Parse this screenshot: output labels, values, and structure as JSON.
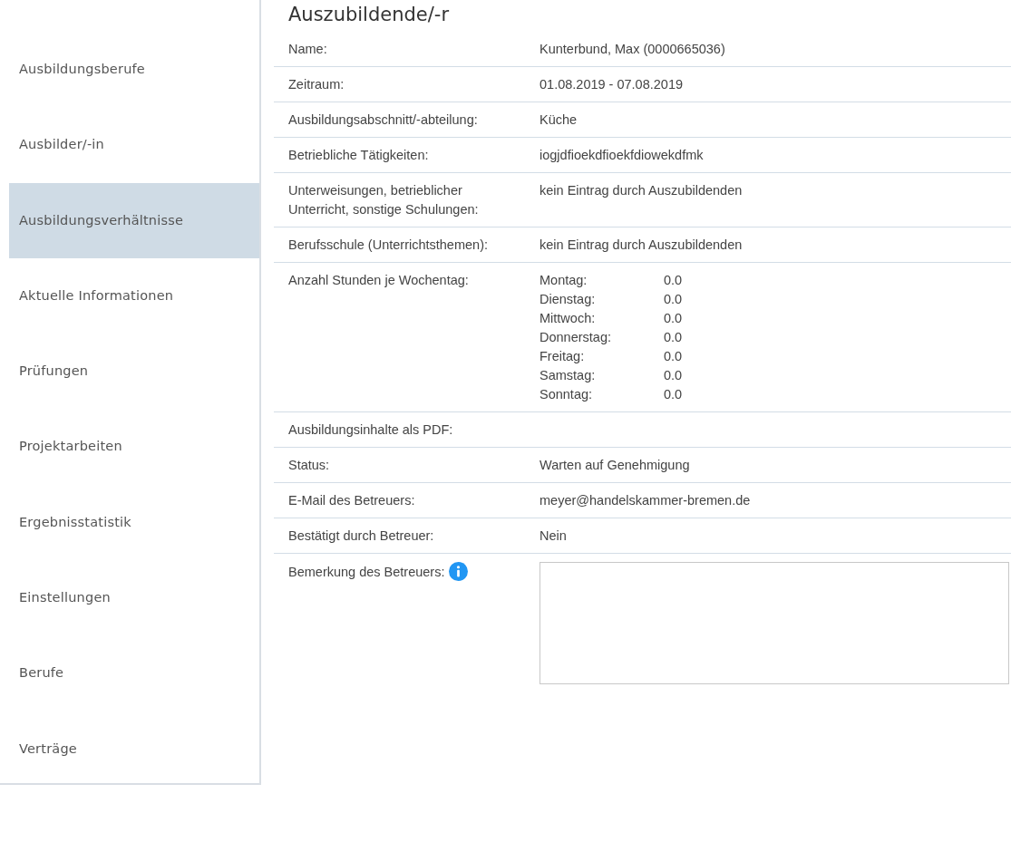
{
  "sidebar": {
    "items": [
      {
        "label": "Ausbildungsberufe",
        "selected": false
      },
      {
        "label": "Ausbilder/-in",
        "selected": false
      },
      {
        "label": "Ausbildungsverhältnisse",
        "selected": true
      },
      {
        "label": "Aktuelle Informationen",
        "selected": false
      },
      {
        "label": "Prüfungen",
        "selected": false
      },
      {
        "label": "Projektarbeiten",
        "selected": false
      },
      {
        "label": "Ergebnisstatistik",
        "selected": false
      },
      {
        "label": "Einstellungen",
        "selected": false
      },
      {
        "label": "Berufe",
        "selected": false
      },
      {
        "label": "Verträge",
        "selected": false
      }
    ]
  },
  "title": "Auszubildende/-r",
  "rows": [
    {
      "kind": "text",
      "label": "Name:",
      "value": "Kunterbund, Max (0000665036)"
    },
    {
      "kind": "text",
      "label": "Zeitraum:",
      "value": "01.08.2019 - 07.08.2019"
    },
    {
      "kind": "text",
      "label": "Ausbildungsabschnitt/-abteilung:",
      "value": "Küche"
    },
    {
      "kind": "text",
      "label": "Betriebliche Tätigkeiten:",
      "value": "iogjdfioekdfioekfdiowekdfmk"
    },
    {
      "kind": "text",
      "label": "Unterweisungen, betrieblicher Unterricht, sonstige Schulungen:",
      "value": "kein Eintrag durch Auszubildenden"
    },
    {
      "kind": "text",
      "label": "Berufsschule (Unterrichtsthemen):",
      "value": "kein Eintrag durch Auszubildenden"
    },
    {
      "kind": "weekdays",
      "label": "Anzahl Stunden je Wochentag:",
      "days": [
        {
          "day": "Montag:",
          "hours": "0.0"
        },
        {
          "day": "Dienstag:",
          "hours": "0.0"
        },
        {
          "day": "Mittwoch:",
          "hours": "0.0"
        },
        {
          "day": "Donnerstag:",
          "hours": "0.0"
        },
        {
          "day": "Freitag:",
          "hours": "0.0"
        },
        {
          "day": "Samstag:",
          "hours": "0.0"
        },
        {
          "day": "Sonntag:",
          "hours": "0.0"
        }
      ]
    },
    {
      "kind": "text",
      "label": "Ausbildungsinhalte als PDF:"
    },
    {
      "kind": "text",
      "label": "Status:",
      "value": "Warten auf Genehmigung"
    },
    {
      "kind": "text",
      "label": "E-Mail des Betreuers:",
      "value": "meyer@handelskammer-bremen.de"
    },
    {
      "kind": "text",
      "label": "Bestätigt durch Betreuer:",
      "value": "Nein"
    },
    {
      "kind": "textarea",
      "label": "Bemerkung des Betreuers:",
      "info": true
    }
  ]
}
